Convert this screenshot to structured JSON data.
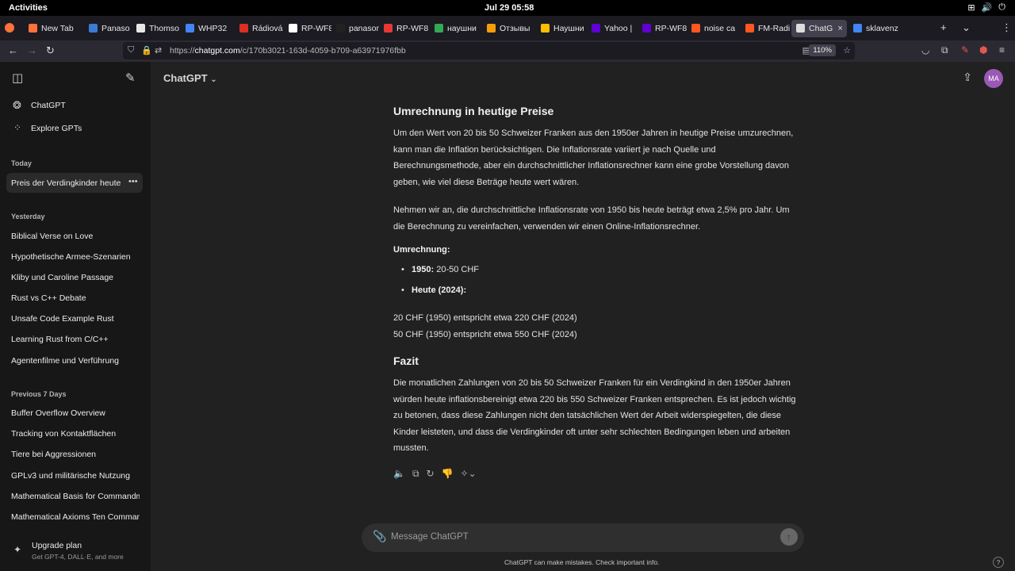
{
  "os": {
    "activities": "Activities",
    "clock": "Jul 29  05:58"
  },
  "tabs": [
    {
      "label": "New Tab",
      "color": "#ff7139"
    },
    {
      "label": "Panaso",
      "color": "#3b7bd4"
    },
    {
      "label": "Thomso",
      "color": "#e7e7e7"
    },
    {
      "label": "WHP32",
      "color": "#4285f4"
    },
    {
      "label": "Rádiová",
      "color": "#d93025"
    },
    {
      "label": "RP-WF8",
      "color": "#ffffff"
    },
    {
      "label": "panason",
      "color": "#222222"
    },
    {
      "label": "RP-WF8",
      "color": "#e53935"
    },
    {
      "label": "наушни",
      "color": "#34a853"
    },
    {
      "label": "Отзывы",
      "color": "#f59e0b"
    },
    {
      "label": "Наушни",
      "color": "#fbbc04"
    },
    {
      "label": "Yahoo | ",
      "color": "#6001d2"
    },
    {
      "label": "RP-WF8",
      "color": "#6001d2"
    },
    {
      "label": "noise ca",
      "color": "#ff5722"
    },
    {
      "label": "FM-Radi",
      "color": "#ff5722"
    },
    {
      "label": "ChatG",
      "color": "#dddddd",
      "active": true
    },
    {
      "label": "sklavenz",
      "color": "#4285f4"
    }
  ],
  "url": {
    "prefix": "https://",
    "domain": "chatgpt.com",
    "path": "/c/170b3021-163d-4059-b709-a63971976fbb",
    "zoom": "110%"
  },
  "sidebar": {
    "nav": [
      {
        "label": "ChatGPT"
      },
      {
        "label": "Explore GPTs"
      }
    ],
    "sections": [
      {
        "heading": "Today",
        "items": [
          "Preis der Verdingkinder heute"
        ]
      },
      {
        "heading": "Yesterday",
        "items": [
          "Biblical Verse on Love",
          "Hypothetische Armee-Szenarien",
          "Kliby und Caroline Passage",
          "Rust vs C++ Debate",
          "Unsafe Code Example Rust",
          "Learning Rust from C/C++",
          "Agentenfilme und Verführung"
        ]
      },
      {
        "heading": "Previous 7 Days",
        "items": [
          "Buffer Overflow Overview",
          "Tracking von Kontaktflächen",
          "Tiere bei Aggressionen",
          "GPLv3 und militärische Nutzung",
          "Mathematical Basis for Commandm",
          "Mathematical Axioms Ten Comman"
        ]
      }
    ],
    "upgrade": {
      "title": "Upgrade plan",
      "subtitle": "Get GPT-4, DALL·E, and more"
    }
  },
  "main": {
    "model": "ChatGPT",
    "avatar": "MA",
    "heading1": "Umrechnung in heutige Preise",
    "para1": "Um den Wert von 20 bis 50 Schweizer Franken aus den 1950er Jahren in heutige Preise umzurechnen, kann man die Inflation berücksichtigen. Die Inflationsrate variiert je nach Quelle und Berechnungsmethode, aber ein durchschnittlicher Inflationsrechner kann eine grobe Vorstellung davon geben, wie viel diese Beträge heute wert wären.",
    "para2": "Nehmen wir an, die durchschnittliche Inflationsrate von 1950 bis heute beträgt etwa 2,5% pro Jahr. Um die Berechnung zu vereinfachen, verwenden wir einen Online-Inflationsrechner.",
    "calc_label": "Umrechnung:",
    "bullets": [
      {
        "bold": "1950:",
        "text": " 20-50 CHF"
      },
      {
        "bold": "Heute (2024):",
        "text": ""
      }
    ],
    "line1": "20 CHF (1950) entspricht etwa 220 CHF (2024)",
    "line2": "50 CHF (1950) entspricht etwa 550 CHF (2024)",
    "heading2": "Fazit",
    "para3": "Die monatlichen Zahlungen von 20 bis 50 Schweizer Franken für ein Verdingkind in den 1950er Jahren würden heute inflationsbereinigt etwa 220 bis 550 Schweizer Franken entsprechen. Es ist jedoch wichtig zu betonen, dass diese Zahlungen nicht den tatsächlichen Wert der Arbeit widerspiegelten, die diese Kinder leisteten, und dass die Verdingkinder oft unter sehr schlechten Bedingungen leben und arbeiten mussten.",
    "composer_placeholder": "Message ChatGPT",
    "disclaimer": "ChatGPT can make mistakes. Check important info."
  }
}
